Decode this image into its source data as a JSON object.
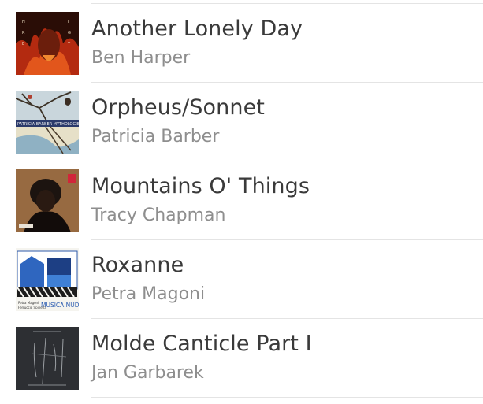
{
  "tracks": [
    {
      "title": "Another Lonely Day",
      "artist": "Ben Harper",
      "art_icon": "album-art-fire-portrait",
      "art_letters": "HARPER FIGHT"
    },
    {
      "title": "Orpheus/Sonnet",
      "artist": "Patricia Barber",
      "art_icon": "album-art-tree-bird",
      "art_letters": "PATRICIA BARBER MYTHOLOGIES"
    },
    {
      "title": "Mountains O' Things",
      "artist": "Tracy Chapman",
      "art_icon": "album-art-portrait-dark"
    },
    {
      "title": "Roxanne",
      "artist": "Petra Magoni",
      "art_icon": "album-art-blue-illustration",
      "art_letters": "Petra Magoni Ferruccio Spinetti MUSICA NUDA"
    },
    {
      "title": "Molde Canticle Part I",
      "artist": "Jan Garbarek",
      "art_icon": "album-art-dark-lines"
    }
  ],
  "colors": {
    "title": "#3a3a3a",
    "artist": "#8e8e8e",
    "divider": "#e4e4e4"
  }
}
